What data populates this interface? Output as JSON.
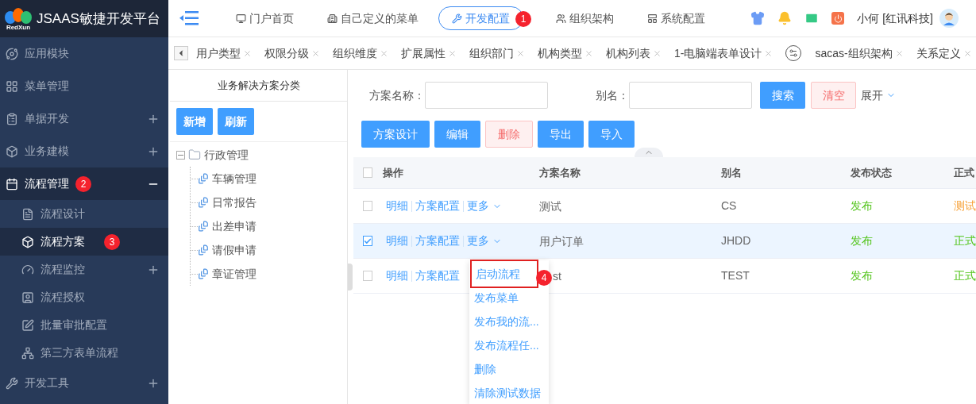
{
  "brand": {
    "logo_text": "RedXun",
    "title": "JSAAS敏捷开发平台"
  },
  "top_nav": [
    {
      "label": "门户首页",
      "selected": false
    },
    {
      "label": "自己定义的菜单",
      "selected": false
    },
    {
      "label": "开发配置",
      "selected": true,
      "badge": "1"
    },
    {
      "label": "组织架构",
      "selected": false
    },
    {
      "label": "系统配置",
      "selected": false
    }
  ],
  "user": {
    "name": "小何 [红讯科技]"
  },
  "tabs": [
    {
      "label": "用户类型"
    },
    {
      "label": "权限分级"
    },
    {
      "label": "组织维度"
    },
    {
      "label": "扩展属性"
    },
    {
      "label": "组织部门"
    },
    {
      "label": "机构类型"
    },
    {
      "label": "机构列表"
    },
    {
      "label": "1-电脑端表单设计"
    },
    {
      "label": "sacas-组织架构",
      "kind": "icon"
    },
    {
      "label": "关系定义"
    }
  ],
  "sidebar": {
    "items": [
      {
        "label": "应用模块",
        "selected": false
      },
      {
        "label": "菜单管理",
        "selected": false
      },
      {
        "label": "单据开发",
        "selected": false,
        "expanded": false
      },
      {
        "label": "业务建模",
        "selected": false,
        "expanded": false
      },
      {
        "label": "流程管理",
        "selected": true,
        "expanded": true,
        "badge": "2",
        "children": [
          {
            "label": "流程设计",
            "selected": false
          },
          {
            "label": "流程方案",
            "selected": true,
            "badge": "3"
          },
          {
            "label": "流程监控",
            "selected": false,
            "expanded": false
          },
          {
            "label": "流程授权",
            "selected": false
          },
          {
            "label": "批量审批配置",
            "selected": false
          },
          {
            "label": "第三方表单流程",
            "selected": false
          }
        ]
      },
      {
        "label": "开发工具",
        "selected": false,
        "expanded": false
      }
    ]
  },
  "category_panel": {
    "title": "业务解决方案分类",
    "buttons": [
      "新增",
      "刷新"
    ],
    "tree": [
      {
        "label": "行政管理",
        "expanded": true,
        "children": [
          {
            "label": "车辆管理"
          },
          {
            "label": "日常报告"
          },
          {
            "label": "出差申请"
          },
          {
            "label": "请假申请"
          },
          {
            "label": "章证管理"
          }
        ]
      }
    ]
  },
  "search": {
    "fields": [
      {
        "label": "方案名称："
      },
      {
        "label": "别名："
      }
    ],
    "search_button": "搜索",
    "clear_button": "清空",
    "expand_link": "展开"
  },
  "toolbar": [
    {
      "label": "方案设计",
      "kind": "primary"
    },
    {
      "label": "编辑",
      "kind": "primary"
    },
    {
      "label": "删除",
      "kind": "danger"
    },
    {
      "label": "导出",
      "kind": "primary"
    },
    {
      "label": "导入",
      "kind": "primary"
    }
  ],
  "table": {
    "all_checked": false,
    "columns": [
      "操作",
      "方案名称",
      "别名",
      "发布状态",
      "正式"
    ],
    "rows": [
      {
        "checked": false,
        "actions": [
          "明细",
          "方案配置",
          "更多"
        ],
        "name": "测试",
        "name_covered": false,
        "alias": "CS",
        "status": "发布",
        "mode": {
          "text": "测试",
          "color": "#f7a035"
        }
      },
      {
        "checked": true,
        "actions": [
          "明细",
          "方案配置",
          "更多"
        ],
        "name": "用户订单",
        "name_covered": false,
        "alias": "JHDD",
        "status": "发布",
        "mode": {
          "text": "正式",
          "color": "#52c41a"
        }
      },
      {
        "checked": false,
        "actions": [
          "明细",
          "方案配置"
        ],
        "name": "st",
        "name_covered": true,
        "alias": "TEST",
        "status": "发布",
        "mode": {
          "text": "正式",
          "color": "#52c41a"
        }
      }
    ]
  },
  "dropdown": {
    "items": [
      {
        "label": "启动流程",
        "highlighted": true,
        "badge": "4"
      },
      {
        "label": "发布菜单",
        "highlighted": false
      },
      {
        "label": "发布我的流...",
        "highlighted": false
      },
      {
        "label": "发布流程任...",
        "highlighted": false
      },
      {
        "label": "删除",
        "highlighted": false
      },
      {
        "label": "清除测试数据",
        "highlighted": false
      }
    ]
  }
}
